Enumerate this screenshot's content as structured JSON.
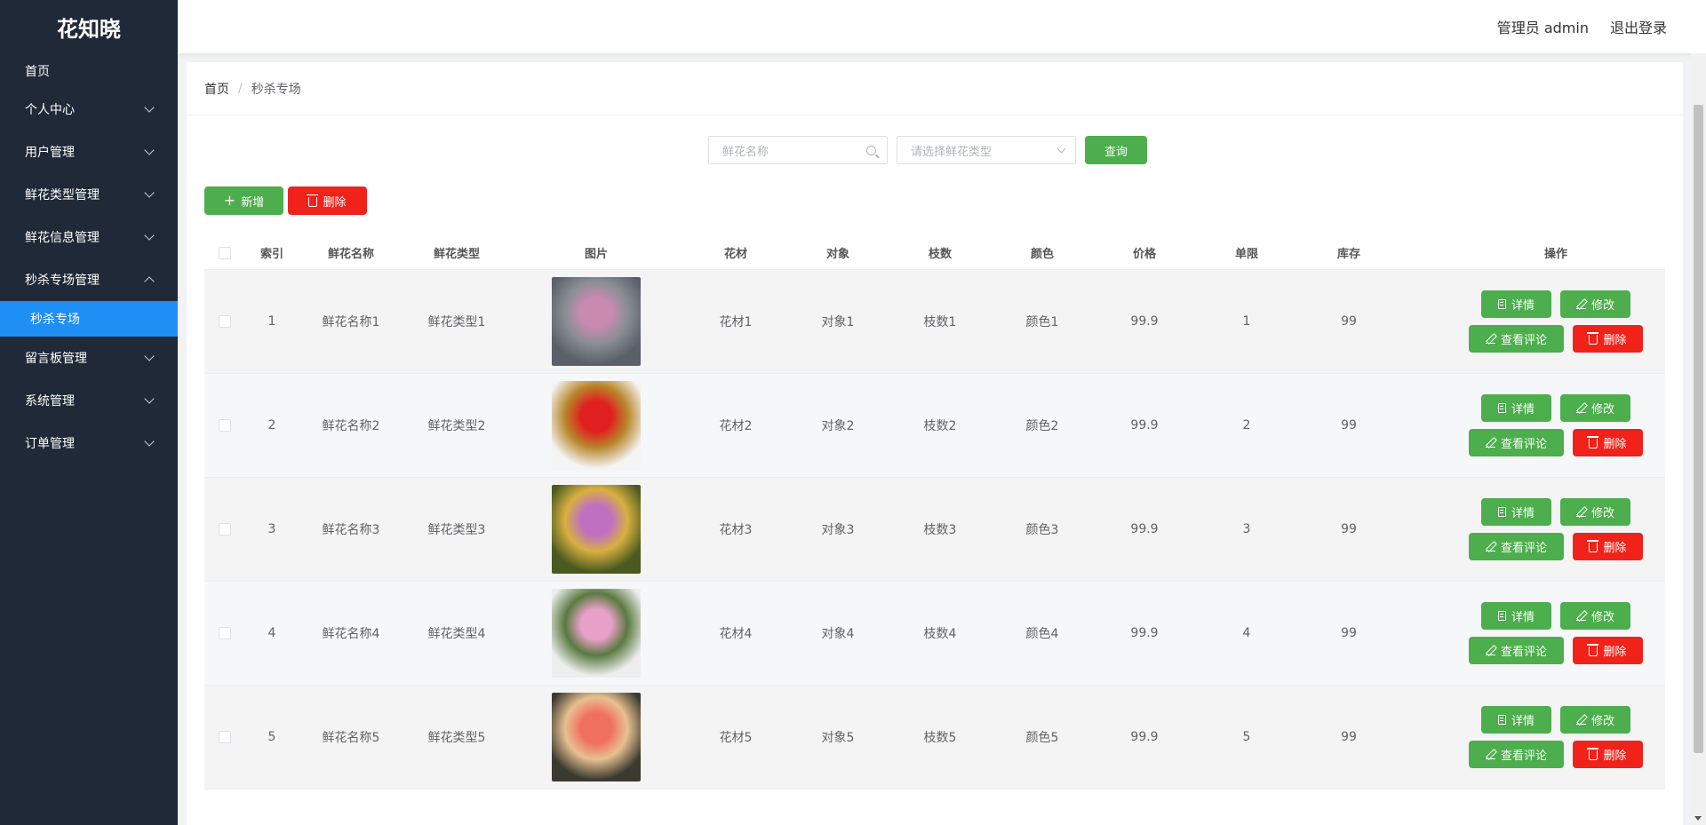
{
  "app": {
    "brand": "花知晓"
  },
  "sidebar": {
    "home": "首页",
    "items": [
      {
        "label": "个人中心"
      },
      {
        "label": "用户管理"
      },
      {
        "label": "鲜花类型管理"
      },
      {
        "label": "鲜花信息管理"
      },
      {
        "label": "秒杀专场管理"
      }
    ],
    "active_sub": "秒杀专场",
    "items_after": [
      {
        "label": "留言板管理"
      },
      {
        "label": "系统管理"
      },
      {
        "label": "订单管理"
      }
    ]
  },
  "header": {
    "user": "管理员 admin",
    "logout": "退出登录"
  },
  "breadcrumb": {
    "home": "首页",
    "sep": "/",
    "current": "秒杀专场"
  },
  "search": {
    "name_placeholder": "鲜花名称",
    "type_placeholder": "请选择鲜花类型",
    "query": "查询"
  },
  "actions": {
    "add": "新增",
    "delete": "删除"
  },
  "table": {
    "headers": [
      "索引",
      "鲜花名称",
      "鲜花类型",
      "图片",
      "花材",
      "对象",
      "枝数",
      "颜色",
      "价格",
      "单限",
      "库存",
      "操作"
    ],
    "op_labels": {
      "detail": "详情",
      "edit": "修改",
      "review": "查看评论",
      "delete": "删除"
    },
    "rows": [
      {
        "idx": "1",
        "name": "鲜花名称1",
        "type": "鲜花类型1",
        "mat": "花材1",
        "obj": "对象1",
        "cnt": "枝数1",
        "color": "颜色1",
        "price": "99.9",
        "limit": "1",
        "stock": "99",
        "img_colors": [
          "#5a5f6a",
          "#c98ab0",
          "#8a8e96"
        ]
      },
      {
        "idx": "2",
        "name": "鲜花名称2",
        "type": "鲜花类型2",
        "mat": "花材2",
        "obj": "对象2",
        "cnt": "枝数2",
        "color": "颜色2",
        "price": "99.9",
        "limit": "2",
        "stock": "99",
        "img_colors": [
          "#f4f4f4",
          "#e02020",
          "#b8862a"
        ]
      },
      {
        "idx": "3",
        "name": "鲜花名称3",
        "type": "鲜花类型3",
        "mat": "花材3",
        "obj": "对象3",
        "cnt": "枝数3",
        "color": "颜色3",
        "price": "99.9",
        "limit": "3",
        "stock": "99",
        "img_colors": [
          "#4a5a20",
          "#c070c0",
          "#d8b040"
        ]
      },
      {
        "idx": "4",
        "name": "鲜花名称4",
        "type": "鲜花类型4",
        "mat": "花材4",
        "obj": "对象4",
        "cnt": "枝数4",
        "color": "颜色4",
        "price": "99.9",
        "limit": "4",
        "stock": "99",
        "img_colors": [
          "#eeeeee",
          "#e8a0c8",
          "#5a7a40"
        ]
      },
      {
        "idx": "5",
        "name": "鲜花名称5",
        "type": "鲜花类型5",
        "mat": "花材5",
        "obj": "对象5",
        "cnt": "枝数5",
        "color": "颜色5",
        "price": "99.9",
        "limit": "5",
        "stock": "99",
        "img_colors": [
          "#3a3a30",
          "#f07060",
          "#e8c090"
        ]
      }
    ]
  }
}
